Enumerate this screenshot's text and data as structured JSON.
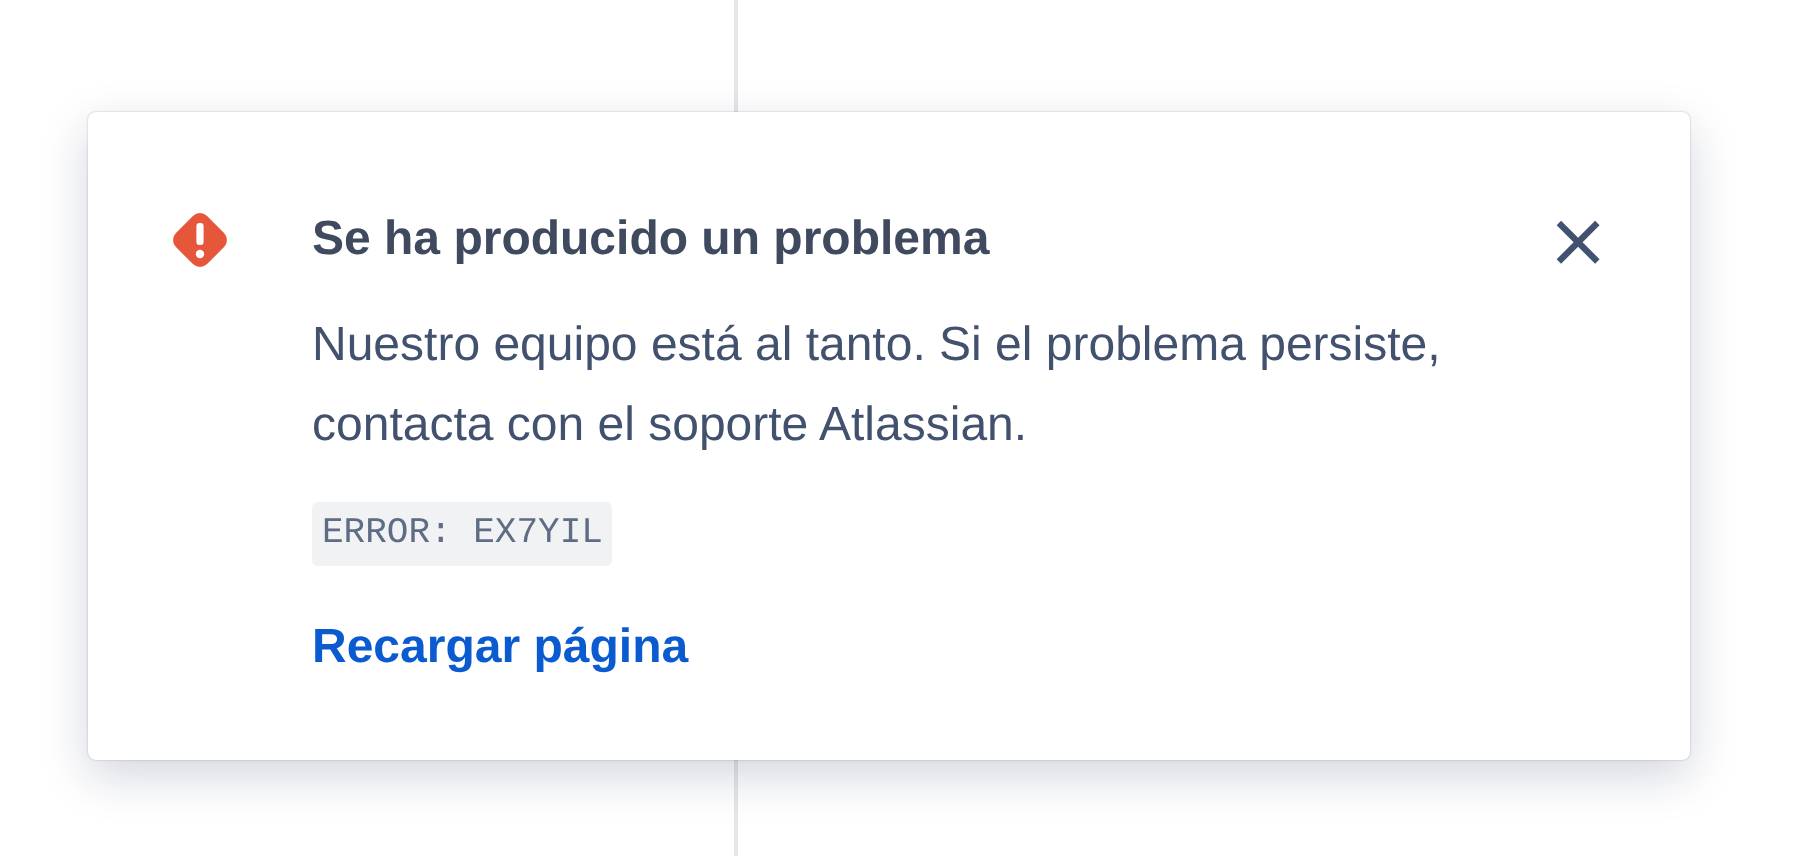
{
  "dialog": {
    "title": "Se ha producido un problema",
    "message": "Nuestro equipo está al tanto. Si el problema persiste, contacta con el soporte Atlassian.",
    "error_code": "ERROR: EX7YIL",
    "link": "Recargar página",
    "close": "×"
  }
}
